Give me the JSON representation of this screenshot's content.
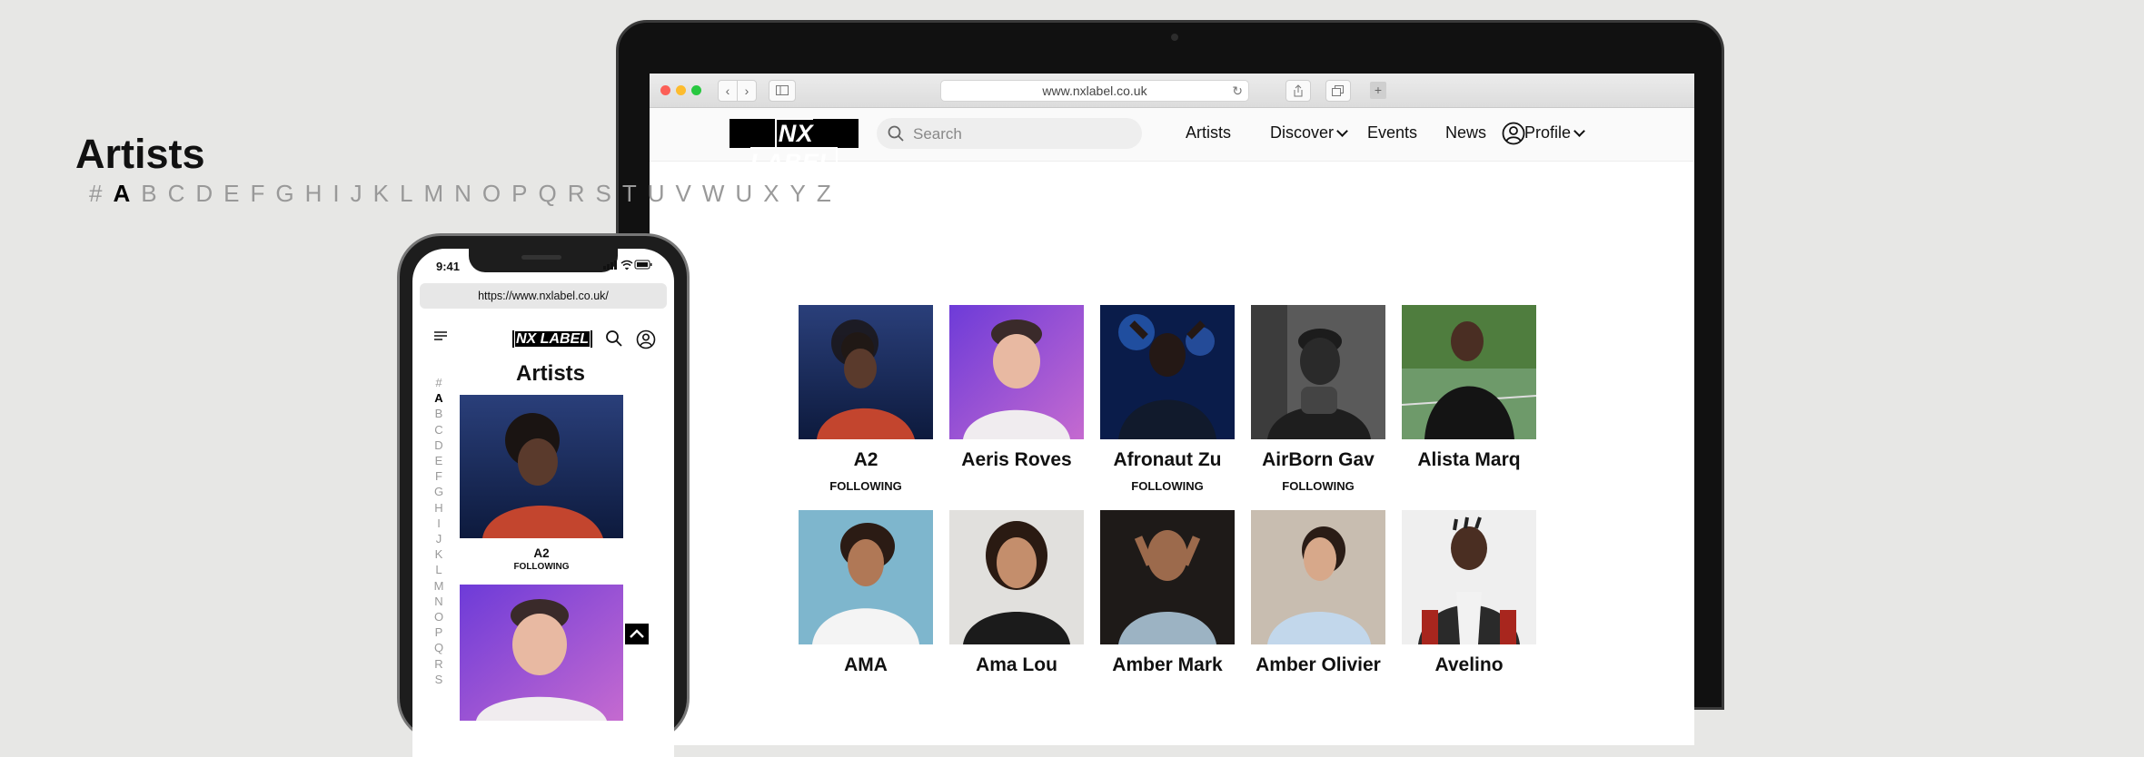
{
  "browser": {
    "url": "www.nxlabel.co.uk"
  },
  "site": {
    "logo": "NX LABEL",
    "search_placeholder": "Search",
    "nav": {
      "artists": "Artists",
      "discover": "Discover",
      "events": "Events",
      "news": "News",
      "profile": "Profile"
    },
    "page_title": "Artists",
    "alphabet": [
      "#",
      "A",
      "B",
      "C",
      "D",
      "E",
      "F",
      "G",
      "H",
      "I",
      "J",
      "K",
      "L",
      "M",
      "N",
      "O",
      "P",
      "Q",
      "R",
      "S",
      "T",
      "U",
      "V",
      "W",
      "U",
      "X",
      "Y",
      "Z"
    ],
    "active_letter": "A",
    "artists": [
      {
        "name": "A2",
        "status": "FOLLOWING"
      },
      {
        "name": "Aeris Roves",
        "status": ""
      },
      {
        "name": "Afronaut Zu",
        "status": "FOLLOWING"
      },
      {
        "name": "AirBorn Gav",
        "status": "FOLLOWING"
      },
      {
        "name": "Alista Marq",
        "status": ""
      },
      {
        "name": "AMA",
        "status": ""
      },
      {
        "name": "Ama Lou",
        "status": ""
      },
      {
        "name": "Amber Mark",
        "status": ""
      },
      {
        "name": "Amber Olivier",
        "status": ""
      },
      {
        "name": "Avelino",
        "status": ""
      }
    ]
  },
  "phone": {
    "time": "9:41",
    "url": "https://www.nxlabel.co.uk/",
    "logo": "NX LABEL",
    "page_title": "Artists",
    "alphabet": [
      "#",
      "A",
      "B",
      "C",
      "D",
      "E",
      "F",
      "G",
      "H",
      "I",
      "J",
      "K",
      "L",
      "M",
      "N",
      "O",
      "P",
      "Q",
      "R",
      "S"
    ],
    "first_artist": {
      "name": "A2",
      "status": "FOLLOWING"
    }
  },
  "colors": {
    "accent": "#000000",
    "inactive_letter": "#999999",
    "background": "#e7e7e5"
  }
}
